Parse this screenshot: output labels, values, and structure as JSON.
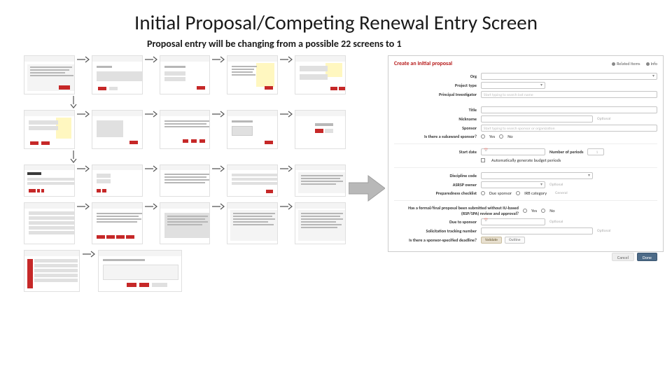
{
  "title": "Initial Proposal/Competing Renewal Entry Screen",
  "subtitle": "Proposal entry will be changing from a possible 22  screens to 1",
  "form": {
    "heading": "Create an initial proposal",
    "toplink_related": "Related Items",
    "toplink_id": "Info",
    "fields": {
      "org_label": "Org",
      "project_type_label": "Project type",
      "pi_label": "Principal Investigator",
      "pi_placeholder": "Start typing to search last name",
      "title_label": "Title",
      "nickname_label": "Nickname",
      "nickname_hint": "Optional",
      "sponsor_label": "Sponsor",
      "sponsor_placeholder": "Start typing to search sponsor or organization",
      "subaward_label": "Is there a subaward sponsor?",
      "yes": "Yes",
      "no": "No",
      "start_label": "Start date",
      "periods_label": "Number of periods",
      "periods_value": "1",
      "auto_budget_label": "Automatically generate budget periods",
      "discipline_label": "Discipline code",
      "asrsp_label": "ASRSP owner",
      "asrsp_hint": "Optional",
      "prep_label": "Preparedness checklist",
      "prep_opt_due": "Due sponsor",
      "prep_opt_irb": "IRB category",
      "prep_opt_general": "General",
      "prior_q_label": "Has a formal/final proposal been submitted without IU-based (RSP/SPA) review and approval?",
      "due_sponsor_label": "Due to sponsor",
      "due_sponsor_hint": "Optional",
      "tracking_label": "Solicitation tracking number",
      "tracking_hint": "Optional",
      "additional_label": "Is there a sponsor-specified deadline?",
      "validate_btn": "Validate",
      "outline_btn": "Outline",
      "cancel_btn": "Cancel",
      "done_btn": "Done"
    }
  }
}
